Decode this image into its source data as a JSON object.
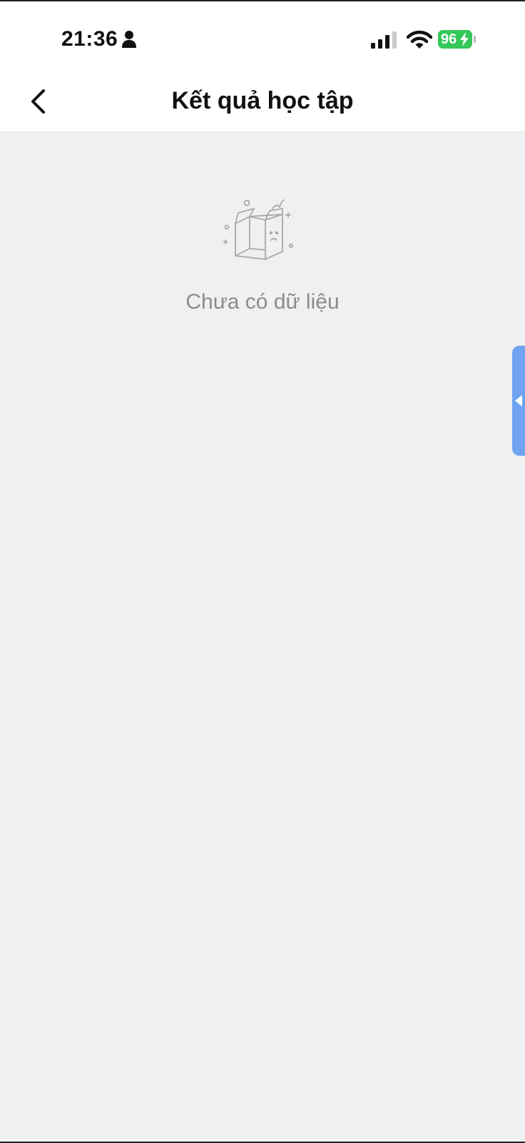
{
  "status_bar": {
    "time": "21:36",
    "battery_level": "96",
    "icons": [
      "person-icon",
      "signal-icon",
      "wifi-icon",
      "bolt-icon"
    ],
    "battery_color": "#34c759"
  },
  "header": {
    "title": "Kết quả học tập",
    "back_icon": "chevron-left-icon"
  },
  "empty_state": {
    "icon": "empty-box-icon",
    "message": "Chưa có dữ liệu"
  },
  "side_handle": {
    "icon": "caret-left-icon",
    "color": "#6fa3f2"
  },
  "colors": {
    "background": "#f0f0f2",
    "header_background": "#ffffff",
    "muted_text": "#8b8b8f"
  }
}
